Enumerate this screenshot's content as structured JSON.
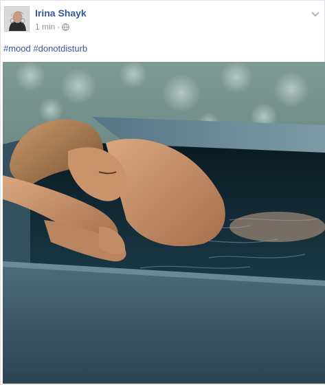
{
  "post": {
    "author": "Irina Shayk",
    "timestamp": "1 min",
    "separator": "·",
    "privacy_icon": "globe-icon",
    "menu_icon": "chevron-down-icon",
    "hashtags": [
      "#mood",
      "#donotdisturb"
    ],
    "photo_icon": "photo-woman-in-pool"
  },
  "colors": {
    "link": "#365899",
    "meta": "#90949c",
    "text": "#1d2129"
  }
}
